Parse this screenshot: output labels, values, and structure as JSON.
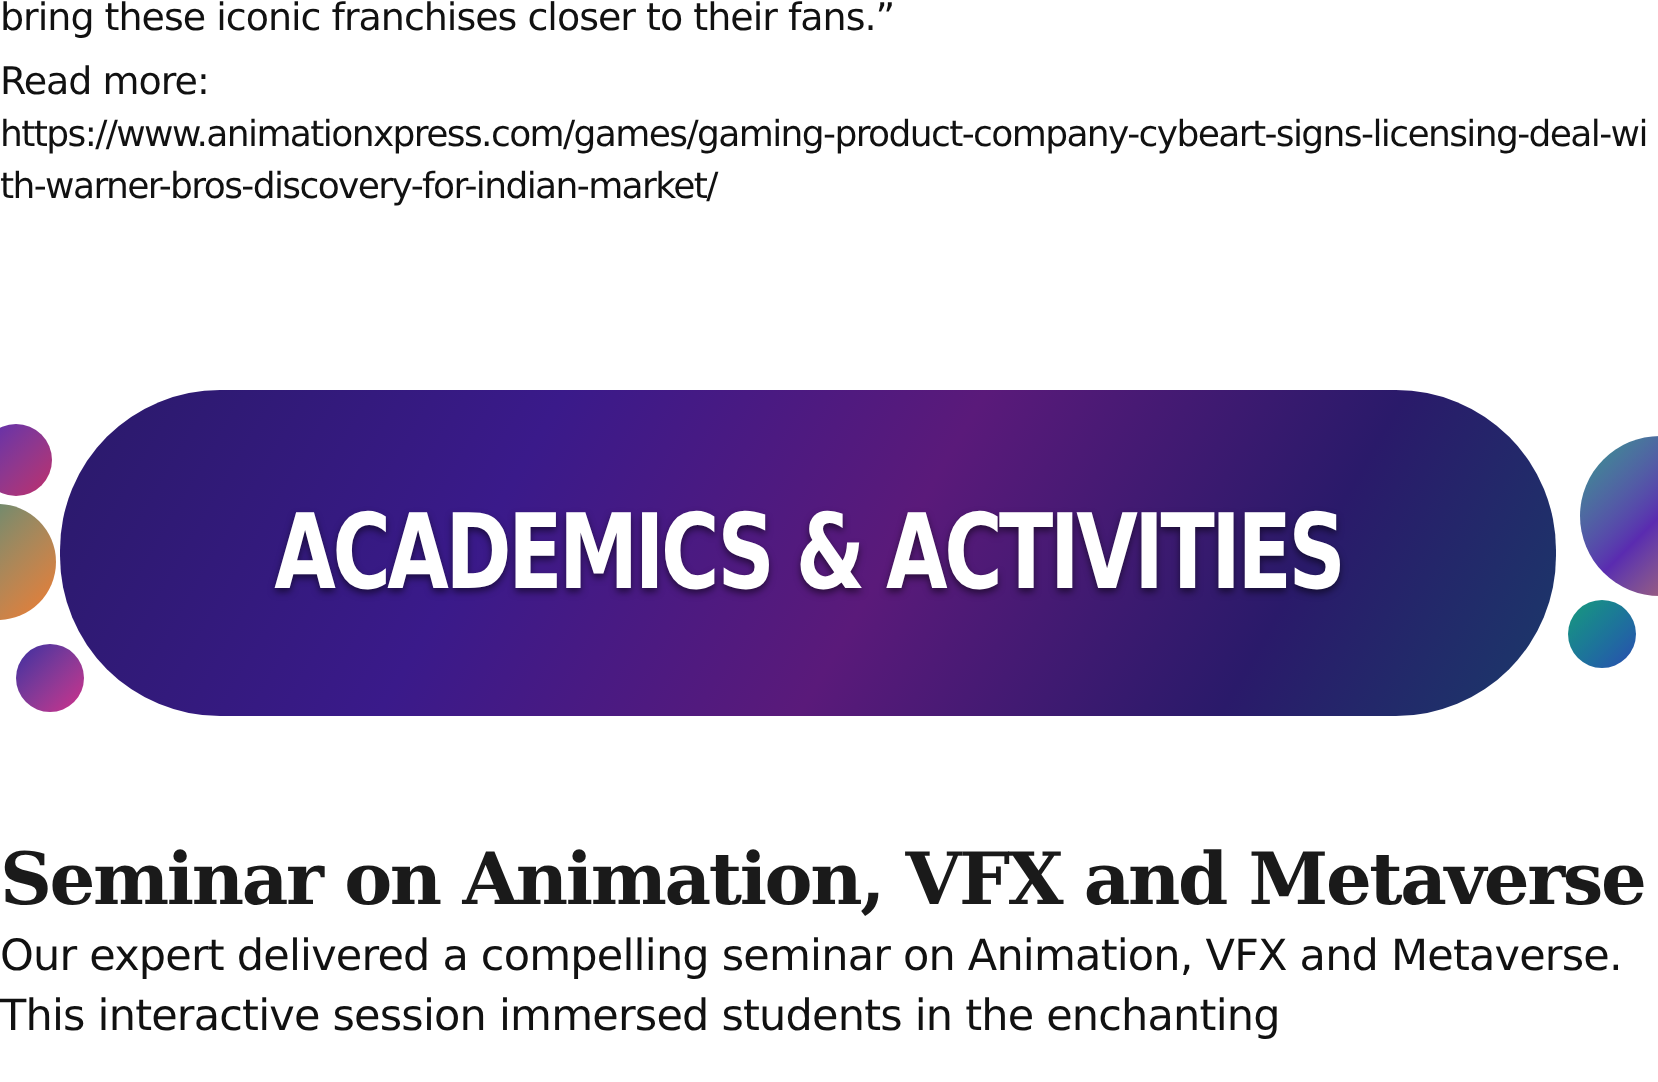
{
  "intro_tail": "bring these iconic franchises closer to their fans.”",
  "read_more": {
    "label": "Read more:",
    "url": "https://www.animationxpress.com/games/gaming-product-company-cybeart-signs-licensing-deal-with-warner-bros-discovery-for-indian-market/"
  },
  "banner": {
    "title": "ACADEMICS & ACTIVITIES"
  },
  "article": {
    "heading": "Seminar on Animation, VFX and Metaverse",
    "body": "Our expert delivered a compelling seminar on Animation, VFX and Metaverse. This interactive session immersed students in the enchanting"
  }
}
